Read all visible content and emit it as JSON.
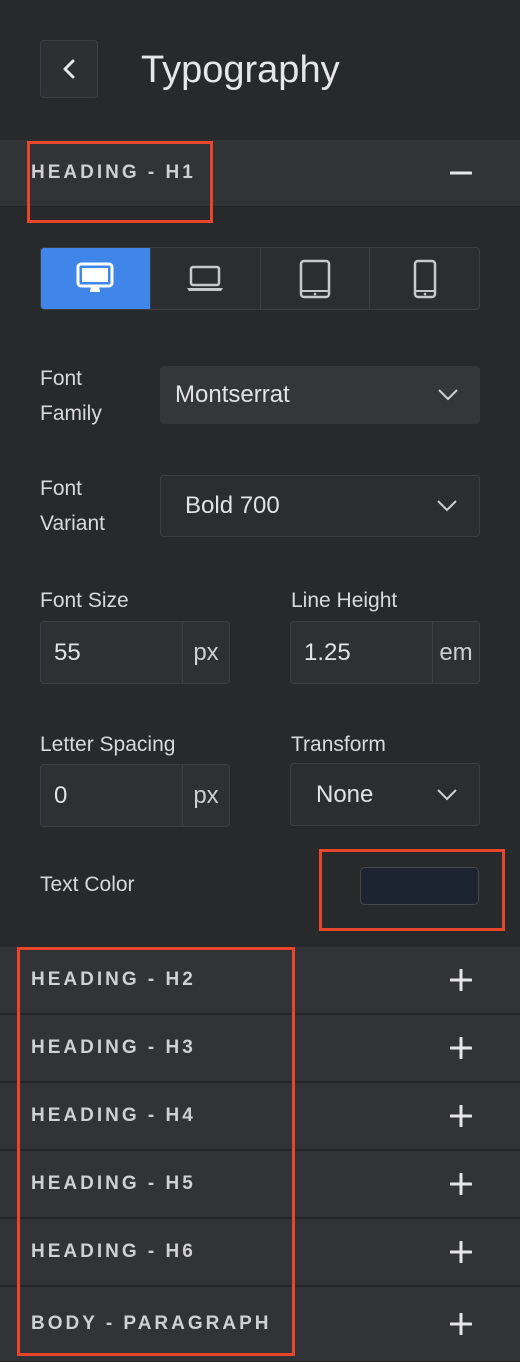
{
  "header": {
    "title": "Typography",
    "back_icon": "chevron-left-icon"
  },
  "sections": {
    "h1": {
      "label": "HEADING - H1",
      "toggle_icon": "minus-icon"
    },
    "h2": {
      "label": "HEADING - H2",
      "toggle_icon": "plus-icon"
    },
    "h3": {
      "label": "HEADING - H3",
      "toggle_icon": "plus-icon"
    },
    "h4": {
      "label": "HEADING - H4",
      "toggle_icon": "plus-icon"
    },
    "h5": {
      "label": "HEADING - H5",
      "toggle_icon": "plus-icon"
    },
    "h6": {
      "label": "HEADING - H6",
      "toggle_icon": "plus-icon"
    },
    "body": {
      "label": "BODY - PARAGRAPH",
      "toggle_icon": "plus-icon"
    }
  },
  "device_tabs": [
    {
      "icon": "desktop-icon",
      "active": true
    },
    {
      "icon": "laptop-icon",
      "active": false
    },
    {
      "icon": "tablet-icon",
      "active": false
    },
    {
      "icon": "mobile-icon",
      "active": false
    }
  ],
  "fields": {
    "font_family": {
      "label_line1": "Font",
      "label_line2": "Family",
      "value": "Montserrat"
    },
    "font_variant": {
      "label_line1": "Font",
      "label_line2": "Variant",
      "value": "Bold 700"
    },
    "font_size": {
      "label": "Font Size",
      "value": "55",
      "unit": "px"
    },
    "line_height": {
      "label": "Line Height",
      "value": "1.25",
      "unit": "em"
    },
    "letter_spacing": {
      "label": "Letter Spacing",
      "value": "0",
      "unit": "px"
    },
    "transform": {
      "label": "Transform",
      "value": "None"
    },
    "text_color": {
      "label": "Text Color",
      "value": "#1c2331"
    }
  },
  "colors": {
    "accent": "#3f86e8",
    "annotation": "#e8462b"
  }
}
